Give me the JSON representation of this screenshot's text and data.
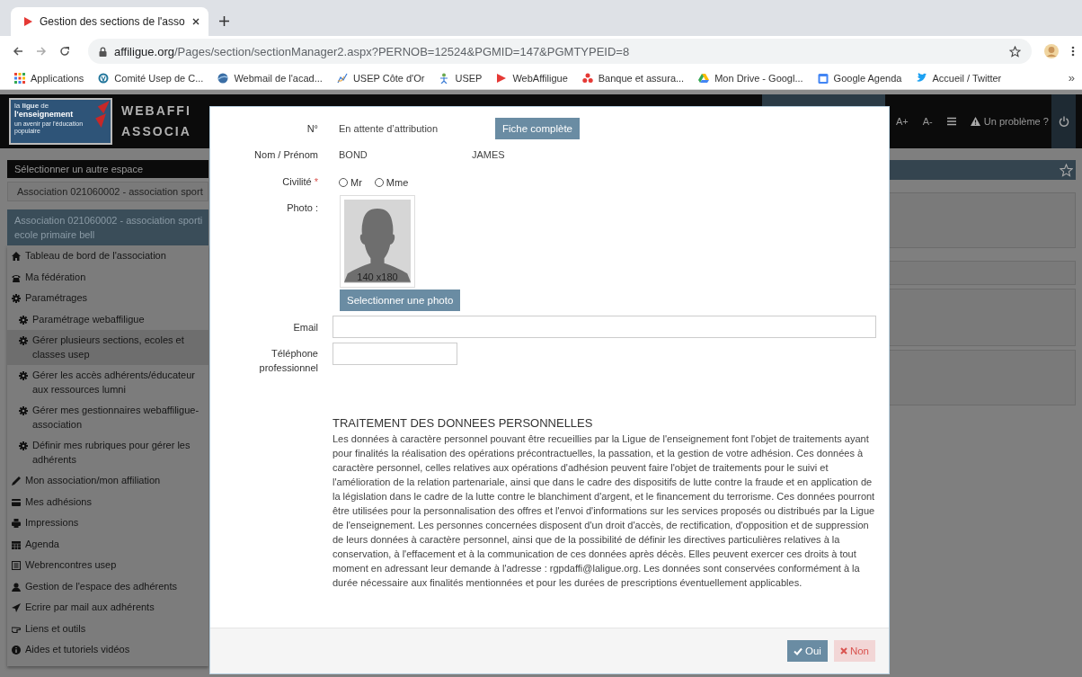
{
  "browser": {
    "tab": {
      "title": "Gestion des sections de l'asso"
    },
    "url": {
      "host": "affiligue.org",
      "path": "/Pages/section/sectionManager2.aspx?PERNOB=12524&PGMID=147&PGMTYPEID=8"
    },
    "bookmarks": [
      {
        "label": "Applications"
      },
      {
        "label": "Comité Usep de C..."
      },
      {
        "label": "Webmail de l'acad..."
      },
      {
        "label": "USEP Côte d'Or"
      },
      {
        "label": "USEP"
      },
      {
        "label": "WebAffiligue"
      },
      {
        "label": "Banque et assura..."
      },
      {
        "label": "Mon Drive - Googl..."
      },
      {
        "label": "Google Agenda"
      },
      {
        "label": "Accueil / Twitter"
      }
    ],
    "more": "»"
  },
  "header": {
    "logo": {
      "line1": "la **ligue** de",
      "line2": "l'enseignement",
      "line3": "un avenir par l'éducation populaire"
    },
    "title_lines": [
      "WEBAFFI",
      "ASSOCIA"
    ],
    "font_larger": "A+",
    "font_smaller": "A-",
    "problem_link": "Un problème ?"
  },
  "sidebar": {
    "space_heading": "Sélectionner un autre espace",
    "space_value": "Association 021060002 - association sport",
    "association_lines": [
      "Association 021060002 - association sporti",
      "ecole primaire bell"
    ],
    "menu": [
      {
        "label": "Tableau de bord de l'association",
        "selected": false
      },
      {
        "label": "Ma fédération",
        "selected": false
      },
      {
        "label": "Paramétrages",
        "selected": false,
        "children": [
          {
            "label": "Paramétrage webaffiligue",
            "selected": false
          },
          {
            "label": "Gérer plusieurs sections, ecoles et classes usep",
            "selected": true
          },
          {
            "lines": [
              "Gérer les accès adhérents/éducateur",
              "aux ressources lumni"
            ],
            "selected": false
          },
          {
            "lines": [
              "Gérer mes gestionnaires webaffiligue-",
              "association"
            ],
            "selected": false
          },
          {
            "label": "Définir mes rubriques pour gérer les adhérents",
            "selected": false
          }
        ]
      },
      {
        "label": "Mon association/mon affiliation",
        "selected": false
      },
      {
        "label": "Mes adhésions",
        "selected": false
      },
      {
        "label": "Impressions",
        "selected": false
      },
      {
        "label": "Agenda",
        "selected": false
      },
      {
        "label": "Webrencontres usep",
        "selected": false
      },
      {
        "label": "Gestion de l'espace des adhérents",
        "selected": false
      },
      {
        "label": "Ecrire par mail aux adhérents",
        "selected": false
      },
      {
        "label": "Liens et outils",
        "selected": false
      },
      {
        "label": "Aides et tutoriels vidéos",
        "selected": false
      }
    ]
  },
  "modal": {
    "number": {
      "label": "N°",
      "value": "En attente d’attribution",
      "button": "Fiche complète"
    },
    "name": {
      "label": "Nom / Prénom",
      "last_name": "BOND",
      "first_name": "JAMES"
    },
    "civility": {
      "label": "Civilité",
      "required_mark": "*",
      "options": [
        {
          "label": "Mr",
          "selected": false
        },
        {
          "label": "Mme",
          "selected": false
        }
      ]
    },
    "photo": {
      "label": "Photo :",
      "size_caption": "140 x180",
      "button": "Selectionner une photo"
    },
    "email": {
      "label": "Email"
    },
    "phone": {
      "label": "Téléphone professionnel"
    },
    "privacy": {
      "title": "TRAITEMENT DES DONNEES PERSONNELLES",
      "text": "Les données à caractère personnel pouvant être recueillies par la Ligue de l'enseignement font l'objet de traitements ayant pour finalités la réalisation des opérations précontractuelles, la passation, et la gestion de votre adhésion. Ces données à caractère personnel, celles relatives aux opérations d'adhésion peuvent faire l'objet de traitements pour le suivi et l'amélioration de la relation partenariale, ainsi que dans le cadre des dispositifs de lutte contre la fraude et en application de la législation dans le cadre de la lutte contre le blanchiment d'argent, et le financement du terrorisme. Ces données pourront être utilisées pour la personnalisation des offres et l'envoi d'informations sur les services proposés ou distribués par la Ligue de l'enseignement. Les personnes concernées disposent d'un droit d'accès, de rectification, d'opposition et de suppression de leurs données à caractère personnel, ainsi que de la possibilité de définir les directives particulières relatives à la conservation, à l'effacement et à la communication de ces données après décès. Elles peuvent exercer ces droits à tout moment en adressant leur demande à l'adresse : rgpdaffi@laligue.org. Les données sont conservées conformément à la durée nécessaire aux finalités mentionnées et pour les durées de prescriptions éventuellement applicables."
    },
    "buttons": [
      {
        "kind": "confirm",
        "label": "Oui"
      },
      {
        "kind": "cancel",
        "label": "Non"
      }
    ]
  }
}
